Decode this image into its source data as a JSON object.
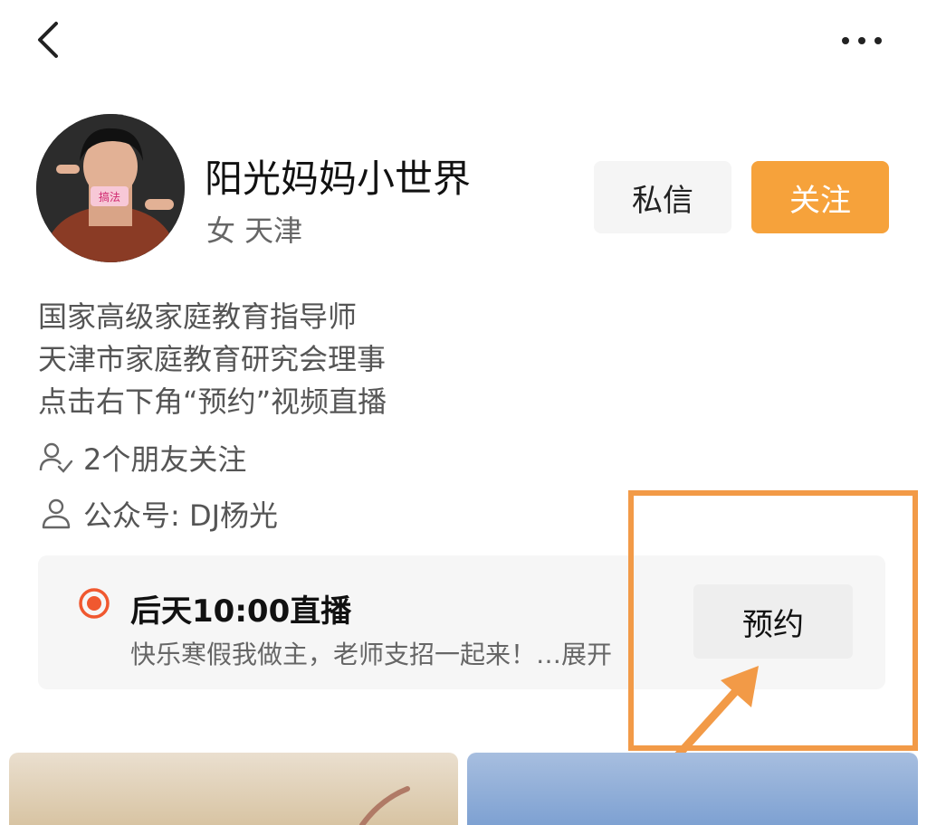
{
  "header": {
    "back_icon": "chevron-left-icon",
    "more_icon": "more-horizontal-icon"
  },
  "profile": {
    "name": "阳光妈妈小世界",
    "meta": "女 天津",
    "avatar_badge": "搞法",
    "message_label": "私信",
    "follow_label": "关注",
    "accent_color": "#f6a23b"
  },
  "bio": {
    "lines": [
      "国家高级家庭教育指导师",
      "天津市家庭教育研究会理事",
      "点击右下角“预约”视频直播"
    ]
  },
  "info": {
    "friends_following": "2个朋友关注",
    "official_account": "公众号: DJ杨光"
  },
  "live": {
    "title": "后天10:00直播",
    "description": "快乐寒假我做主，老师支招一起来！…展开",
    "reserve_label": "预约",
    "dot_color": "#f0582f"
  },
  "annotation": {
    "color": "#f29a47"
  }
}
